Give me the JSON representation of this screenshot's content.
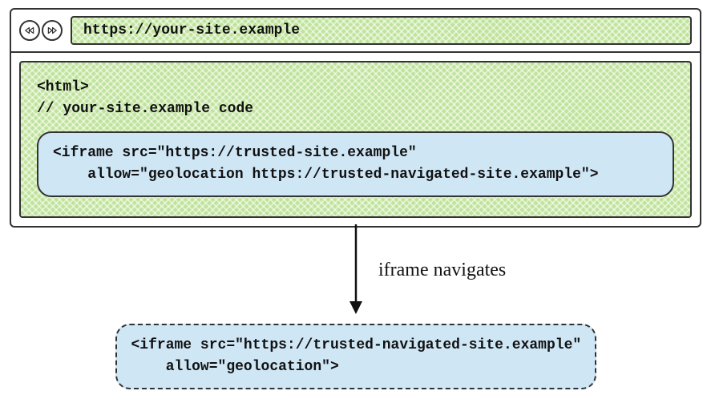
{
  "browser": {
    "address_url": "https://your-site.example",
    "html_open": "<html>",
    "comment": "// your-site.example code",
    "iframe_line1": "<iframe src=\"https://trusted-site.example\"",
    "iframe_line2": "    allow=\"geolocation https://trusted-navigated-site.example\">"
  },
  "arrow_label": "iframe navigates",
  "result": {
    "line1": "<iframe src=\"https://trusted-navigated-site.example\"",
    "line2": "    allow=\"geolocation\">"
  },
  "colors": {
    "green_hatch": "#bfe39a",
    "blue_box": "#cfe6f5",
    "stroke": "#333333"
  }
}
